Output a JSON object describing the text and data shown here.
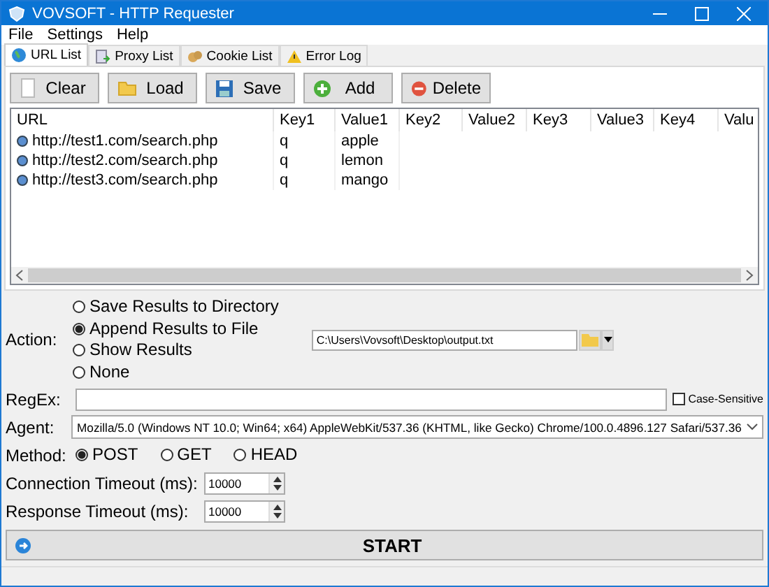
{
  "window": {
    "title": "VOVSOFT - HTTP Requester"
  },
  "menu": [
    "File",
    "Settings",
    "Help"
  ],
  "tabs": [
    {
      "label": "URL List",
      "selected": true
    },
    {
      "label": "Proxy List",
      "selected": false
    },
    {
      "label": "Cookie List",
      "selected": false
    },
    {
      "label": "Error Log",
      "selected": false
    }
  ],
  "toolbar": [
    "Clear",
    "Load",
    "Save",
    "Add",
    "Delete"
  ],
  "table": {
    "columns": [
      "URL",
      "Key1",
      "Value1",
      "Key2",
      "Value2",
      "Key3",
      "Value3",
      "Key4",
      "Valu"
    ],
    "rows": [
      [
        "http://test1.com/search.php",
        "q",
        "apple"
      ],
      [
        "http://test2.com/search.php",
        "q",
        "lemon"
      ],
      [
        "http://test3.com/search.php",
        "q",
        "mango"
      ]
    ]
  },
  "action": {
    "label": "Action:",
    "options": [
      {
        "label": "Save Results to Directory",
        "selected": false
      },
      {
        "label": "Append Results to File",
        "selected": true
      },
      {
        "label": "Show Results",
        "selected": false
      },
      {
        "label": "None",
        "selected": false
      }
    ],
    "path": "C:\\Users\\Vovsoft\\Desktop\\output.txt"
  },
  "regex": {
    "label": "RegEx:",
    "case_sensitive": {
      "label": "Case-Sensitive",
      "checked": false
    }
  },
  "agent": {
    "label": "Agent:",
    "value": "Mozilla/5.0 (Windows NT 10.0; Win64; x64) AppleWebKit/537.36 (KHTML, like Gecko) Chrome/100.0.4896.127 Safari/537.36"
  },
  "method": {
    "label": "Method:",
    "options": [
      {
        "label": "POST",
        "selected": true
      },
      {
        "label": "GET",
        "selected": false
      },
      {
        "label": "HEAD",
        "selected": false
      }
    ]
  },
  "timeouts": [
    {
      "label": "Connection Timeout (ms):",
      "value": "10000"
    },
    {
      "label": "Response Timeout (ms):",
      "value": "10000"
    }
  ],
  "start": "START"
}
